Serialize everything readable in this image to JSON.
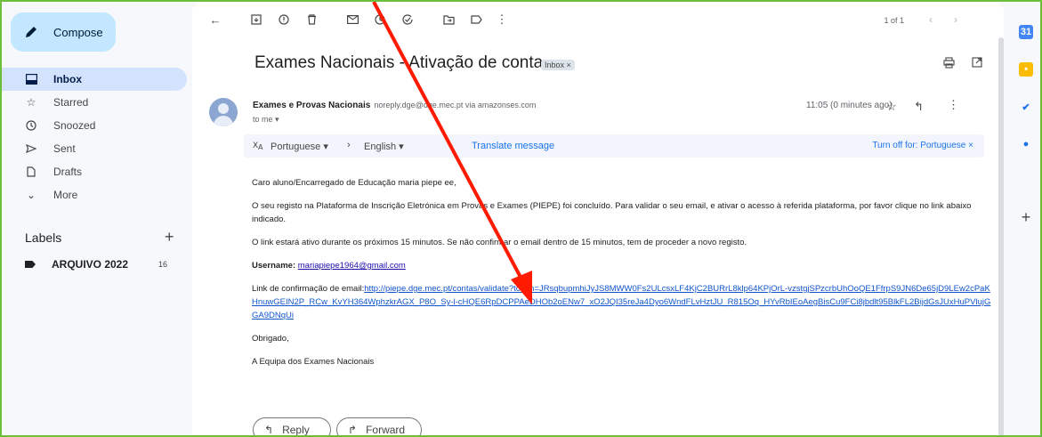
{
  "sidebar": {
    "compose_label": "Compose",
    "items": [
      {
        "label": "Inbox",
        "icon": "inbox-icon"
      },
      {
        "label": "Starred",
        "icon": "star-icon"
      },
      {
        "label": "Snoozed",
        "icon": "clock-icon"
      },
      {
        "label": "Sent",
        "icon": "send-icon"
      },
      {
        "label": "Drafts",
        "icon": "draft-icon"
      },
      {
        "label": "More",
        "icon": "chevron-down-icon"
      }
    ],
    "labels_title": "Labels",
    "label_item": {
      "name": "ARQUIVO 2022",
      "count": "16"
    }
  },
  "toolbar": {
    "pager": "1 of 1"
  },
  "email": {
    "subject": "Exames Nacionais - Ativação de conta",
    "inbox_badge": "Inbox ×",
    "sender_name": "Exames e Provas Nacionais",
    "sender_email": "noreply.dge@dge.mec.pt via amazonses.com",
    "to": "to me ▾",
    "time": "11:05 (0 minutes ago)",
    "translate": {
      "from": "Portuguese ▾",
      "to": "English ▾",
      "link": "Translate message",
      "turnoff": "Turn off for: Portuguese ×"
    },
    "greeting": "Caro aluno/Encarregado de Educação maria piepe ee,",
    "para1": "O seu registo na Plataforma de Inscrição Eletrónica em Provas e Exames (PIEPE) foi concluído. Para validar o seu email, e ativar o acesso à referida plataforma, por favor clique no link abaixo indicado.",
    "para2": "O link estará ativo durante os próximos 15 minutos. Se não confirmar o email dentro de 15 minutos, tem de proceder a novo registo.",
    "username_label": "Username:",
    "username_value": "mariapiepe1964@gmail.com",
    "link_label": "Link de confirmação de email:",
    "link_value": "http://piepe.dge.mec.pt/contas/validate?token=JRsqbupmhiJyJS8MWW0Fs2ULcsxLF4KjC2BURrL8klp64KPjOrL-vzstgjSPzcrbUhOoQE1FfrpS9JN6De65jD9LEw2cPaKHnuwGEIN2P_RCw_KvYH364WphzkrAGX_P8O_Sy-l-cHQE6RpDCPPAeDHOb2oENw7_xO2JQI35reJa4Dyo6WndFLvHztJU_R815Oq_HYvRbIEoAegBisCu9FCi8jbdlt95BlkFL2BijdGsJUxHuPVlujGGA9DNqUi",
    "signoff": "Obrigado,",
    "team": "A Equipa dos Exames Nacionais"
  },
  "actions": {
    "reply": "Reply",
    "forward": "Forward"
  },
  "colors": {
    "accent": "#1a73e8",
    "compose_bg": "#c2e7ff",
    "active_nav": "#d3e3fd",
    "annotation_arrow": "#ff1a00",
    "frame_border": "#6cbf3a"
  }
}
